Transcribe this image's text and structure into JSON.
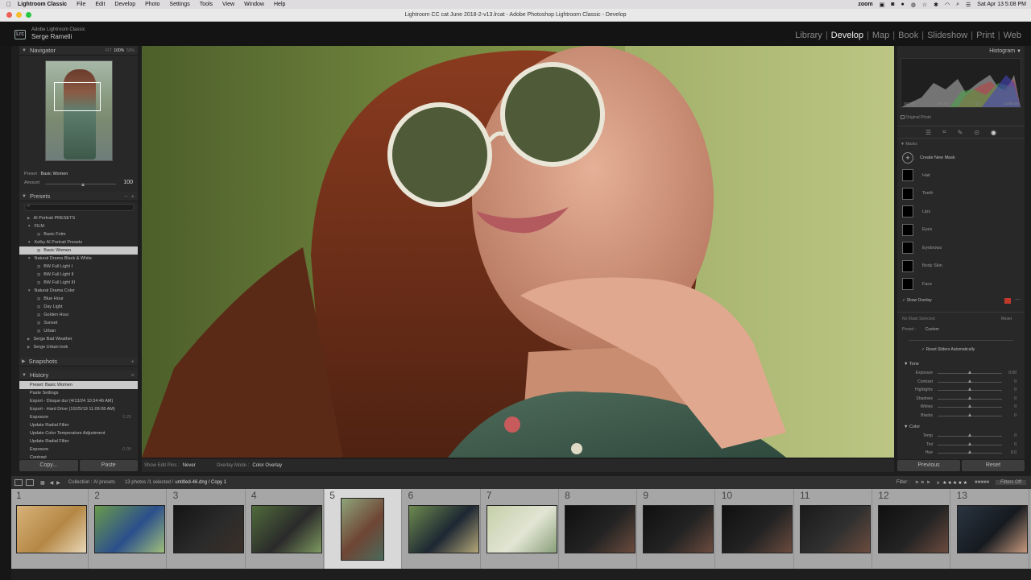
{
  "menubar": {
    "app": "Lightroom Classic",
    "items": [
      "File",
      "Edit",
      "Develop",
      "Photo",
      "Settings",
      "Tools",
      "View",
      "Window",
      "Help"
    ],
    "zoom": "zoom",
    "datetime": "Sat Apr 13  5:08 PM"
  },
  "window": {
    "title": "Lightroom CC cat June 2018-2-v13.lrcat - Adobe Photoshop Lightroom Classic - Develop"
  },
  "identity": {
    "line1": "Adobe Lightroom Classic",
    "line2": "Serge Ramelli",
    "badge": "Lrc"
  },
  "modules": [
    "Library",
    "Develop",
    "Map",
    "Book",
    "Slideshow",
    "Print",
    "Web"
  ],
  "active_module": "Develop",
  "navigator": {
    "title": "Navigator",
    "zoom_options": [
      "FIT",
      "100%",
      "50%"
    ]
  },
  "preset_line": {
    "label": "Preset :",
    "value": "Basic Women"
  },
  "amount": {
    "label": "Amount",
    "value": "100"
  },
  "presets": {
    "title": "Presets",
    "items": [
      {
        "label": "AI Portrait PRESETS",
        "level": 0,
        "type": "folder"
      },
      {
        "label": "FILM",
        "level": 0,
        "type": "folder-open"
      },
      {
        "label": "Basic Folm",
        "level": 1,
        "type": "preset"
      },
      {
        "label": "Kelby AI Portrait Presets",
        "level": 0,
        "type": "folder-open"
      },
      {
        "label": "Basic Women",
        "level": 1,
        "type": "preset",
        "selected": true
      },
      {
        "label": "Natural Drama Black & White",
        "level": 0,
        "type": "folder-open"
      },
      {
        "label": "BW Full Light I",
        "level": 1,
        "type": "preset"
      },
      {
        "label": "BW Full Light II",
        "level": 1,
        "type": "preset"
      },
      {
        "label": "BW Full Light III",
        "level": 1,
        "type": "preset"
      },
      {
        "label": "Natural Drama Color",
        "level": 0,
        "type": "folder-open"
      },
      {
        "label": "Blue Hour",
        "level": 1,
        "type": "preset"
      },
      {
        "label": "Day Light",
        "level": 1,
        "type": "preset"
      },
      {
        "label": "Golden Hour",
        "level": 1,
        "type": "preset"
      },
      {
        "label": "Sunset",
        "level": 1,
        "type": "preset"
      },
      {
        "label": "Urban",
        "level": 1,
        "type": "preset"
      },
      {
        "label": "Serge Bad Weather",
        "level": 0,
        "type": "folder"
      },
      {
        "label": "Serge Urban look",
        "level": 0,
        "type": "folder"
      }
    ]
  },
  "snapshots": {
    "title": "Snapshots"
  },
  "history": {
    "title": "History",
    "items": [
      {
        "label": "Preset: Basic Women",
        "value": "",
        "selected": true
      },
      {
        "label": "Paste Settings",
        "value": ""
      },
      {
        "label": "Export - Disque dur (4/13/24 10:34:46 AM)",
        "value": ""
      },
      {
        "label": "Export - Hard Drive (10/25/19 11:09:08 AM)",
        "value": ""
      },
      {
        "label": "Exposure",
        "value": "0.25"
      },
      {
        "label": "Update Radial Filter",
        "value": ""
      },
      {
        "label": "Update Color Temperature Adjustment",
        "value": ""
      },
      {
        "label": "Update Radial Filter",
        "value": ""
      },
      {
        "label": "Exposure",
        "value": "0.05"
      },
      {
        "label": "Contrast",
        "value": ""
      }
    ]
  },
  "left_buttons": {
    "copy": "Copy...",
    "paste": "Paste"
  },
  "toolbar": {
    "show_edit_pins_label": "Show Edit Pins :",
    "show_edit_pins_value": "Never",
    "overlay_mode_label": "Overlay Mode :",
    "overlay_mode_value": "Color Overlay"
  },
  "right_panel": {
    "histogram_title": "Histogram",
    "exif": [
      "ISO 50",
      "85 mm",
      "f / 2.0",
      "1/400 sec"
    ],
    "original_photo": "Original Photo",
    "masks_title": "Masks",
    "create_new_mask": "Create New Mask",
    "masks": [
      "Hair",
      "Teeth",
      "Lips",
      "Eyes",
      "Eyebrows",
      "Body Skin",
      "Face"
    ],
    "show_overlay": "Show Overlay",
    "no_mask_selected": "No Mask Selected",
    "reset": "Reset",
    "preset_label": "Preset :",
    "preset_value": "Custom",
    "reset_sliders_auto": "Reset Sliders Automatically",
    "tone_title": "Tone",
    "tone_sliders": [
      {
        "label": "Exposure",
        "value": "0.00"
      },
      {
        "label": "Contrast",
        "value": "0"
      },
      {
        "label": "Highlights",
        "value": "0"
      },
      {
        "label": "Shadows",
        "value": "0"
      },
      {
        "label": "Whites",
        "value": "0"
      },
      {
        "label": "Blacks",
        "value": "0"
      }
    ],
    "color_title": "Color",
    "color_sliders": [
      {
        "label": "Temp",
        "value": "0"
      },
      {
        "label": "Tint",
        "value": "0"
      },
      {
        "label": "Hue",
        "value": "0.0"
      }
    ]
  },
  "right_buttons": {
    "previous": "Previous",
    "reset": "Reset"
  },
  "filmbar": {
    "collection": "Collection : AI presets",
    "count": "13 photos /1 selected /",
    "filename": "untitled-46.dng / Copy 1",
    "filter_label": "Filter :",
    "filters_off": "Filters Off"
  },
  "filmstrip": [
    {
      "num": "1",
      "colors": [
        "#d8b27a",
        "#b48744",
        "#e9d7b8"
      ]
    },
    {
      "num": "2",
      "colors": [
        "#6a9a4b",
        "#2b4f8c",
        "#a0c07a"
      ]
    },
    {
      "num": "3",
      "colors": [
        "#141414",
        "#2b2b2b",
        "#3a2f28"
      ]
    },
    {
      "num": "4",
      "colors": [
        "#4f6b3b",
        "#2a2a2a",
        "#7e9a60"
      ]
    },
    {
      "num": "5",
      "colors": [
        "#8ea47a",
        "#6f4535",
        "#4b6a5a"
      ],
      "selected": true
    },
    {
      "num": "6",
      "colors": [
        "#6d8a4e",
        "#1d2733",
        "#b4a778"
      ]
    },
    {
      "num": "7",
      "colors": [
        "#c5cfa8",
        "#e2e5d4",
        "#8aa07a"
      ]
    },
    {
      "num": "8",
      "colors": [
        "#101010",
        "#232323",
        "#6b4b3e"
      ]
    },
    {
      "num": "9",
      "colors": [
        "#101010",
        "#232323",
        "#6b4b3e"
      ]
    },
    {
      "num": "10",
      "colors": [
        "#101010",
        "#232323",
        "#6b4b3e"
      ]
    },
    {
      "num": "11",
      "colors": [
        "#1a1a1a",
        "#303030",
        "#6b4b3e"
      ]
    },
    {
      "num": "12",
      "colors": [
        "#101010",
        "#232323",
        "#6b4b3e"
      ]
    },
    {
      "num": "13",
      "colors": [
        "#2a3440",
        "#151a20",
        "#c79a7d"
      ]
    }
  ]
}
